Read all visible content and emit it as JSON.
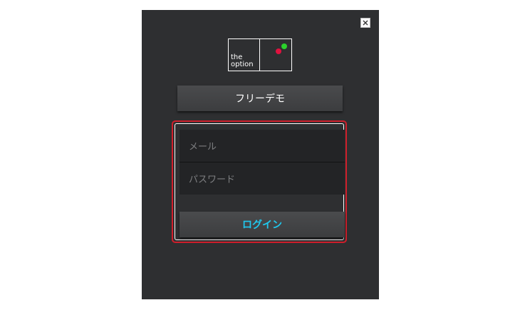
{
  "window": {
    "close_icon": "close-icon"
  },
  "logo": {
    "text": "the\noption",
    "green_dot_color": "#2bd12b",
    "red_dot_color": "#e0123f"
  },
  "demo_button": {
    "label": "フリーデモ"
  },
  "login_form": {
    "email": {
      "value": "",
      "placeholder": "メール"
    },
    "password": {
      "value": "",
      "placeholder": "パスワード"
    },
    "login_button": {
      "label": "ログイン"
    },
    "highlight_color": "#cf1f2b"
  },
  "colors": {
    "window_background": "#2e2f31",
    "input_background": "#232426",
    "login_label": "#1fc8ee"
  }
}
